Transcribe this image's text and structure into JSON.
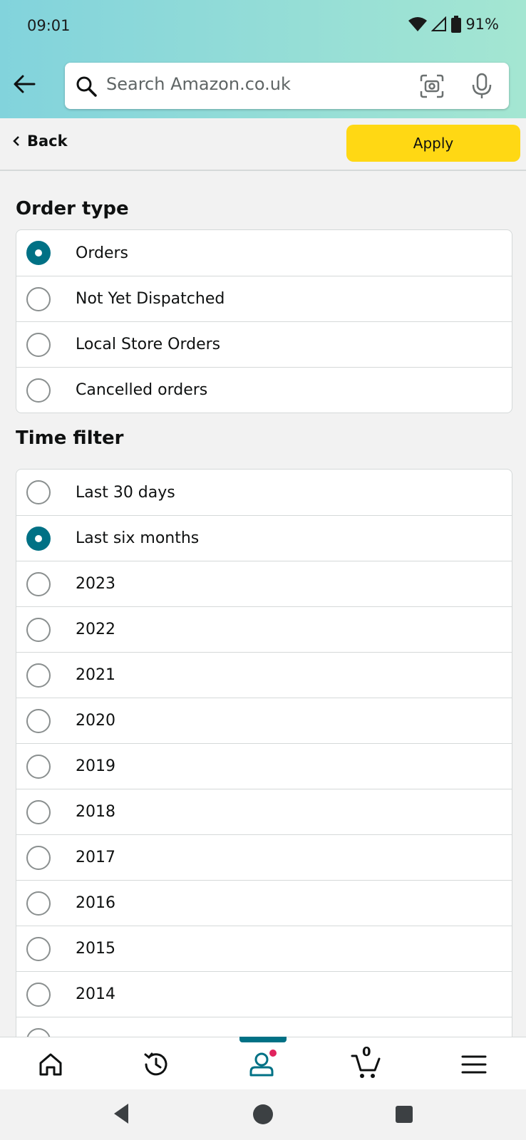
{
  "status_bar": {
    "time": "09:01",
    "battery": "91%"
  },
  "search": {
    "placeholder": "Search Amazon.co.uk"
  },
  "action_bar": {
    "back_label": "Back",
    "apply_label": "Apply"
  },
  "order_type": {
    "title": "Order type",
    "options": [
      {
        "label": "Orders",
        "selected": true
      },
      {
        "label": "Not Yet Dispatched",
        "selected": false
      },
      {
        "label": "Local Store Orders",
        "selected": false
      },
      {
        "label": "Cancelled orders",
        "selected": false
      }
    ]
  },
  "time_filter": {
    "title": "Time filter",
    "options": [
      {
        "label": "Last 30 days",
        "selected": false
      },
      {
        "label": "Last six months",
        "selected": true
      },
      {
        "label": "2023",
        "selected": false
      },
      {
        "label": "2022",
        "selected": false
      },
      {
        "label": "2021",
        "selected": false
      },
      {
        "label": "2020",
        "selected": false
      },
      {
        "label": "2019",
        "selected": false
      },
      {
        "label": "2018",
        "selected": false
      },
      {
        "label": "2017",
        "selected": false
      },
      {
        "label": "2016",
        "selected": false
      },
      {
        "label": "2015",
        "selected": false
      },
      {
        "label": "2014",
        "selected": false
      },
      {
        "label": "",
        "selected": false
      }
    ]
  },
  "bottom_nav": {
    "items": [
      "home-icon",
      "history-icon",
      "account-icon",
      "cart-icon",
      "menu-icon"
    ],
    "active": "account-icon",
    "cart_count": "0"
  },
  "colors": {
    "accent": "#007185",
    "apply": "#ffd814",
    "badge": "#e0245e"
  }
}
